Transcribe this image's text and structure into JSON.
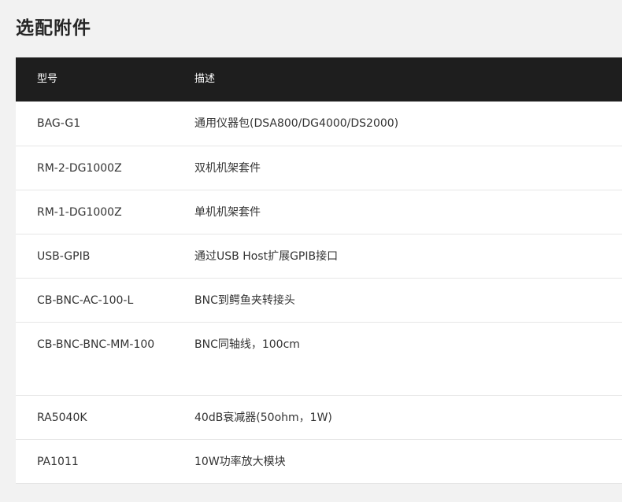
{
  "section": {
    "title": "选配附件"
  },
  "table": {
    "headers": {
      "model": "型号",
      "description": "描述"
    },
    "rows": [
      {
        "model": "BAG-G1",
        "description": "通用仪器包(DSA800/DG4000/DS2000)"
      },
      {
        "model": "RM-2-DG1000Z",
        "description": "双机机架套件"
      },
      {
        "model": "RM-1-DG1000Z",
        "description": "单机机架套件"
      },
      {
        "model": "USB-GPIB",
        "description": "通过USB Host扩展GPIB接口"
      },
      {
        "model": "CB-BNC-AC-100-L",
        "description": "BNC到鳄鱼夹转接头"
      },
      {
        "model": "CB-BNC-BNC-MM-100",
        "description": "BNC同轴线，100cm"
      },
      {
        "model": "RA5040K",
        "description": "40dB衰减器(50ohm，1W)"
      },
      {
        "model": "PA1011",
        "description": "10W功率放大模块"
      }
    ]
  }
}
